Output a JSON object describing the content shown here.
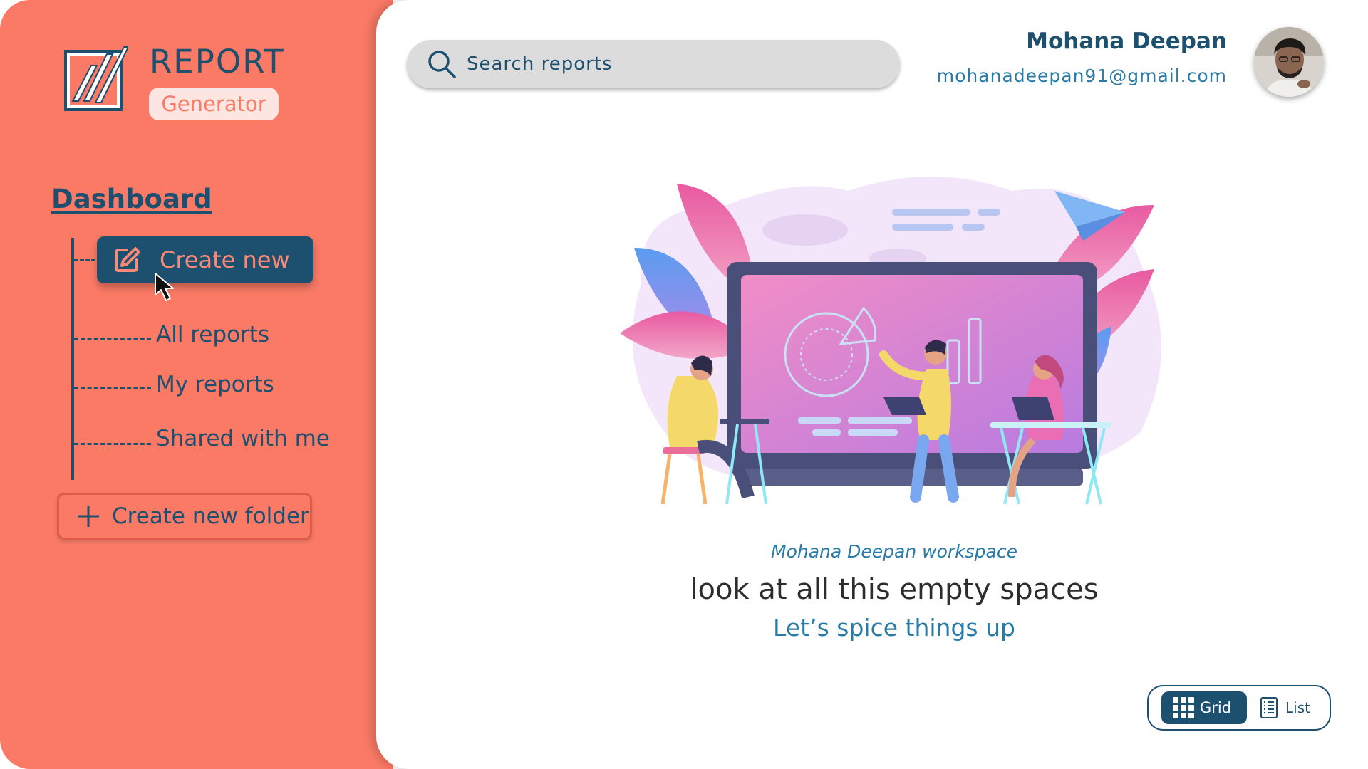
{
  "brand": {
    "title": "REPORT",
    "subtitle": "Generator"
  },
  "sidebar": {
    "heading": "Dashboard",
    "create_new": "Create new",
    "items": [
      {
        "label": "All reports"
      },
      {
        "label": "My reports"
      },
      {
        "label": "Shared with me"
      }
    ],
    "create_folder": "Create new folder"
  },
  "search": {
    "placeholder": "Search reports"
  },
  "user": {
    "name": "Mohana Deepan",
    "email": "mohanadeepan91@gmail.com"
  },
  "workspace": {
    "owner": "Mohana Deepan",
    "suffix": "workspace",
    "empty_title": "look at all this empty spaces",
    "cta": "Let’s spice things up"
  },
  "view_toggle": {
    "grid_label": "Grid",
    "list_label": "List",
    "selected": "Grid"
  },
  "colors": {
    "sidebar": "#fa7a66",
    "navy": "#1d4f6e",
    "accent_blue": "#2a7aa6"
  }
}
